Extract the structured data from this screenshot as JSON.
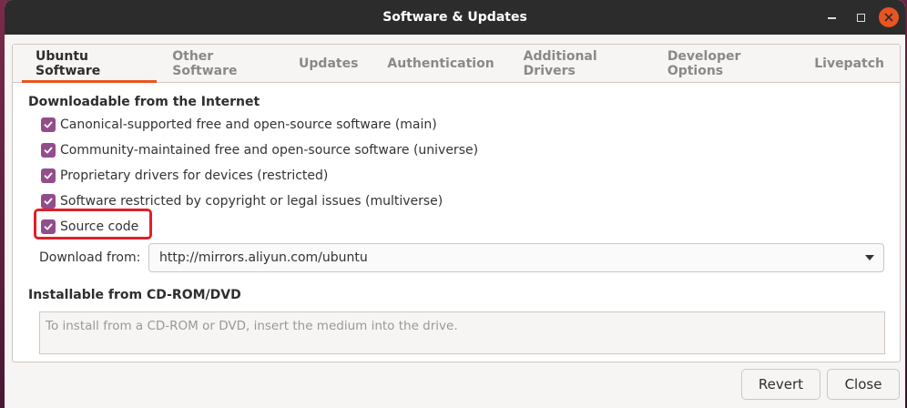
{
  "window": {
    "title": "Software & Updates"
  },
  "tabs": [
    {
      "label": "Ubuntu Software",
      "active": true
    },
    {
      "label": "Other Software",
      "active": false
    },
    {
      "label": "Updates",
      "active": false
    },
    {
      "label": "Authentication",
      "active": false
    },
    {
      "label": "Additional Drivers",
      "active": false
    },
    {
      "label": "Developer Options",
      "active": false
    },
    {
      "label": "Livepatch",
      "active": false
    }
  ],
  "downloadable": {
    "heading": "Downloadable from the Internet",
    "options": [
      {
        "label": "Canonical-supported free and open-source software (main)",
        "checked": true
      },
      {
        "label": "Community-maintained free and open-source software (universe)",
        "checked": true
      },
      {
        "label": "Proprietary drivers for devices (restricted)",
        "checked": true
      },
      {
        "label": "Software restricted by copyright or legal issues (multiverse)",
        "checked": true
      },
      {
        "label": "Source code",
        "checked": true
      }
    ],
    "download_from_label": "Download from:",
    "download_from_value": "http://mirrors.aliyun.com/ubuntu"
  },
  "cdrom": {
    "heading": "Installable from CD-ROM/DVD",
    "placeholder": "To install from a CD-ROM or DVD, insert the medium into the drive."
  },
  "buttons": {
    "revert": "Revert",
    "close": "Close"
  },
  "colors": {
    "accent": "#e95420",
    "checkbox": "#924d8b",
    "highlight": "#e0202a",
    "titlebar": "#2c2c2c"
  }
}
